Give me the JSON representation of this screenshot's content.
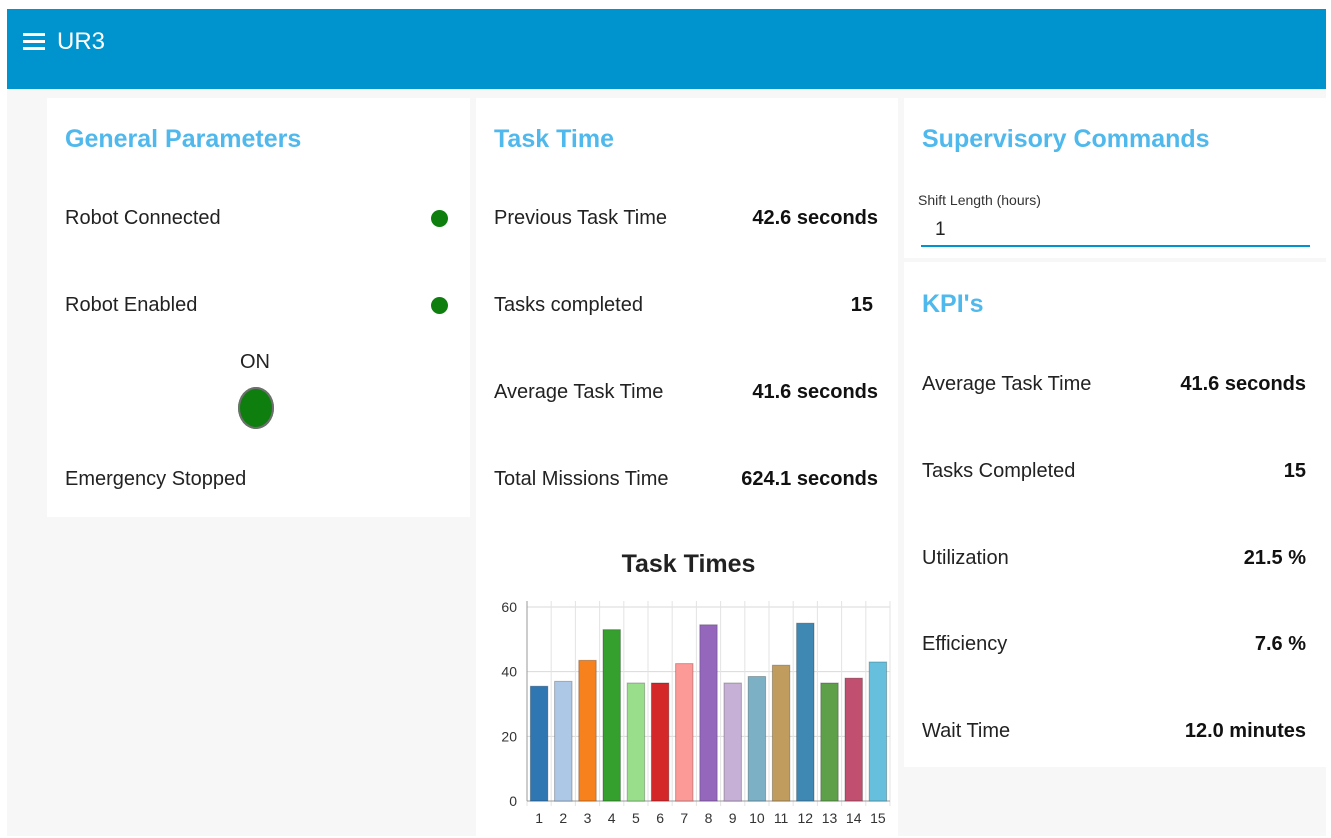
{
  "header": {
    "title": "UR3"
  },
  "general": {
    "title": "General Parameters",
    "robot_connected": "Robot Connected",
    "robot_enabled": "Robot Enabled",
    "on_label": "ON",
    "emergency_stopped": "Emergency Stopped",
    "led_color": "#0e7e0e"
  },
  "task_time": {
    "title": "Task Time",
    "rows": [
      {
        "label": "Previous Task Time",
        "value": "42.6 seconds"
      },
      {
        "label": "Tasks completed",
        "value": "15"
      },
      {
        "label": "Average Task Time",
        "value": "41.6 seconds"
      },
      {
        "label": "Total Missions Time",
        "value": "624.1 seconds"
      }
    ]
  },
  "supervisory": {
    "title": "Supervisory Commands",
    "shift_label": "Shift Length (hours)",
    "shift_value": "1"
  },
  "kpis": {
    "title": "KPI's",
    "rows": [
      {
        "label": "Average Task Time",
        "value": "41.6 seconds"
      },
      {
        "label": "Tasks Completed",
        "value": "15"
      },
      {
        "label": "Utilization",
        "value": "21.5 %"
      },
      {
        "label": "Efficiency",
        "value": "7.6 %"
      },
      {
        "label": "Wait Time",
        "value": "12.0 minutes"
      }
    ]
  },
  "chart_data": {
    "type": "bar",
    "title": "Task Times",
    "categories": [
      "1",
      "2",
      "3",
      "4",
      "5",
      "6",
      "7",
      "8",
      "9",
      "10",
      "11",
      "12",
      "13",
      "14",
      "15"
    ],
    "values": [
      35.5,
      37,
      43.5,
      53,
      36.5,
      36.5,
      42.5,
      54.5,
      36.5,
      38.5,
      42,
      55,
      36.5,
      38,
      43
    ],
    "colors": [
      "#2f77b3",
      "#adc8e6",
      "#f7821d",
      "#36a02f",
      "#99df8b",
      "#d3272a",
      "#fc9a98",
      "#9467bd",
      "#c6b0d5",
      "#7cb1c5",
      "#c09c5f",
      "#3f88b4",
      "#5ea04a",
      "#c14f6f",
      "#66c0dd"
    ],
    "ylim": [
      0,
      60
    ],
    "yticks": [
      0,
      20,
      40,
      60
    ],
    "grid": true
  },
  "icons": {
    "menu": "hamburger-menu-icon",
    "status_led": "status-led-icon"
  }
}
